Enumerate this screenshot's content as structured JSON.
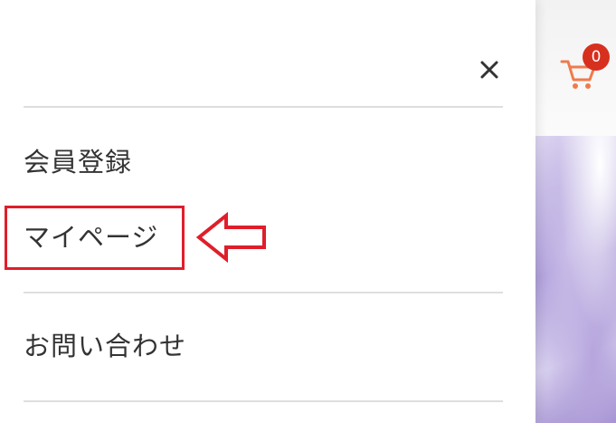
{
  "header": {
    "cart": {
      "count": "0",
      "icon": "cart-icon",
      "color": "#f07a4c",
      "badge_color": "#d7301f"
    }
  },
  "drawer": {
    "close_icon": "close-icon",
    "items": [
      {
        "label": "会員登録"
      },
      {
        "label": "マイページ"
      },
      {
        "label": "お問い合わせ"
      }
    ]
  },
  "annotation": {
    "highlight_color": "#e01e2b",
    "target": "マイページ"
  }
}
